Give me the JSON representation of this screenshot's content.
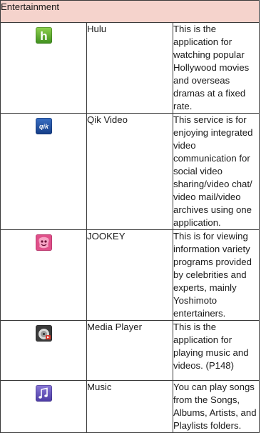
{
  "section": {
    "title": "Entertainment",
    "header_bg": "#f5d3cc"
  },
  "apps": [
    {
      "name": "Hulu",
      "icon": "hulu-icon",
      "description": "This is the application for watching popular Hollywood movies and overseas dramas at a fixed rate."
    },
    {
      "name": "Qik Video",
      "icon": "qik-video-icon",
      "description": "This service is for enjoying integrated video communication for social video sharing/video chat/ video mail/video archives using one application."
    },
    {
      "name": "JOOKEY",
      "icon": "jookey-icon",
      "description": "This is for viewing information variety programs provided by celebrities and experts, mainly Yoshimoto entertainers."
    },
    {
      "name": "Media Player",
      "icon": "media-player-icon",
      "description": "This is the application for playing music and videos. (P148)"
    },
    {
      "name": "Music",
      "icon": "music-icon",
      "description": "You can play songs from the Songs, Albums, Artists, and Playlists folders."
    }
  ],
  "icon_text": {
    "hulu": "h",
    "qik": "qik"
  }
}
